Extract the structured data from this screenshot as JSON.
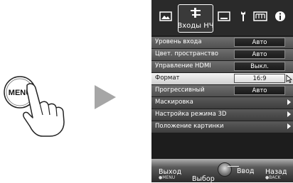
{
  "illustration": {
    "button_label": "MENU"
  },
  "tabs": [
    {
      "icon": "picture-icon"
    },
    {
      "icon": "input-signal-icon",
      "label": "Входы НЧ",
      "active": true
    },
    {
      "icon": "screen-icon"
    },
    {
      "icon": "wrench-icon"
    },
    {
      "icon": "display-icon"
    },
    {
      "icon": "info-icon"
    }
  ],
  "menu": {
    "rows": [
      {
        "label": "Уровень входа",
        "value": "Авто"
      },
      {
        "label": "Цвет. пространство",
        "value": "Авто"
      },
      {
        "label": "Управление HDMI",
        "value": "Выкл."
      },
      {
        "label": "Формат",
        "value": "16:9",
        "selected": true
      },
      {
        "label": "Прогрессивный",
        "value": "Авто"
      },
      {
        "label": "Маскировка",
        "submenu": true
      },
      {
        "label": "Настройка режима 3D",
        "submenu": true
      },
      {
        "label": "Положение картинки",
        "submenu": true
      }
    ]
  },
  "footer": {
    "exit_label": "Выход",
    "exit_key": "●MENU",
    "select_label": "Выбор",
    "enter_label": "Ввод",
    "back_label": "Назад",
    "back_key": "●BACK"
  }
}
